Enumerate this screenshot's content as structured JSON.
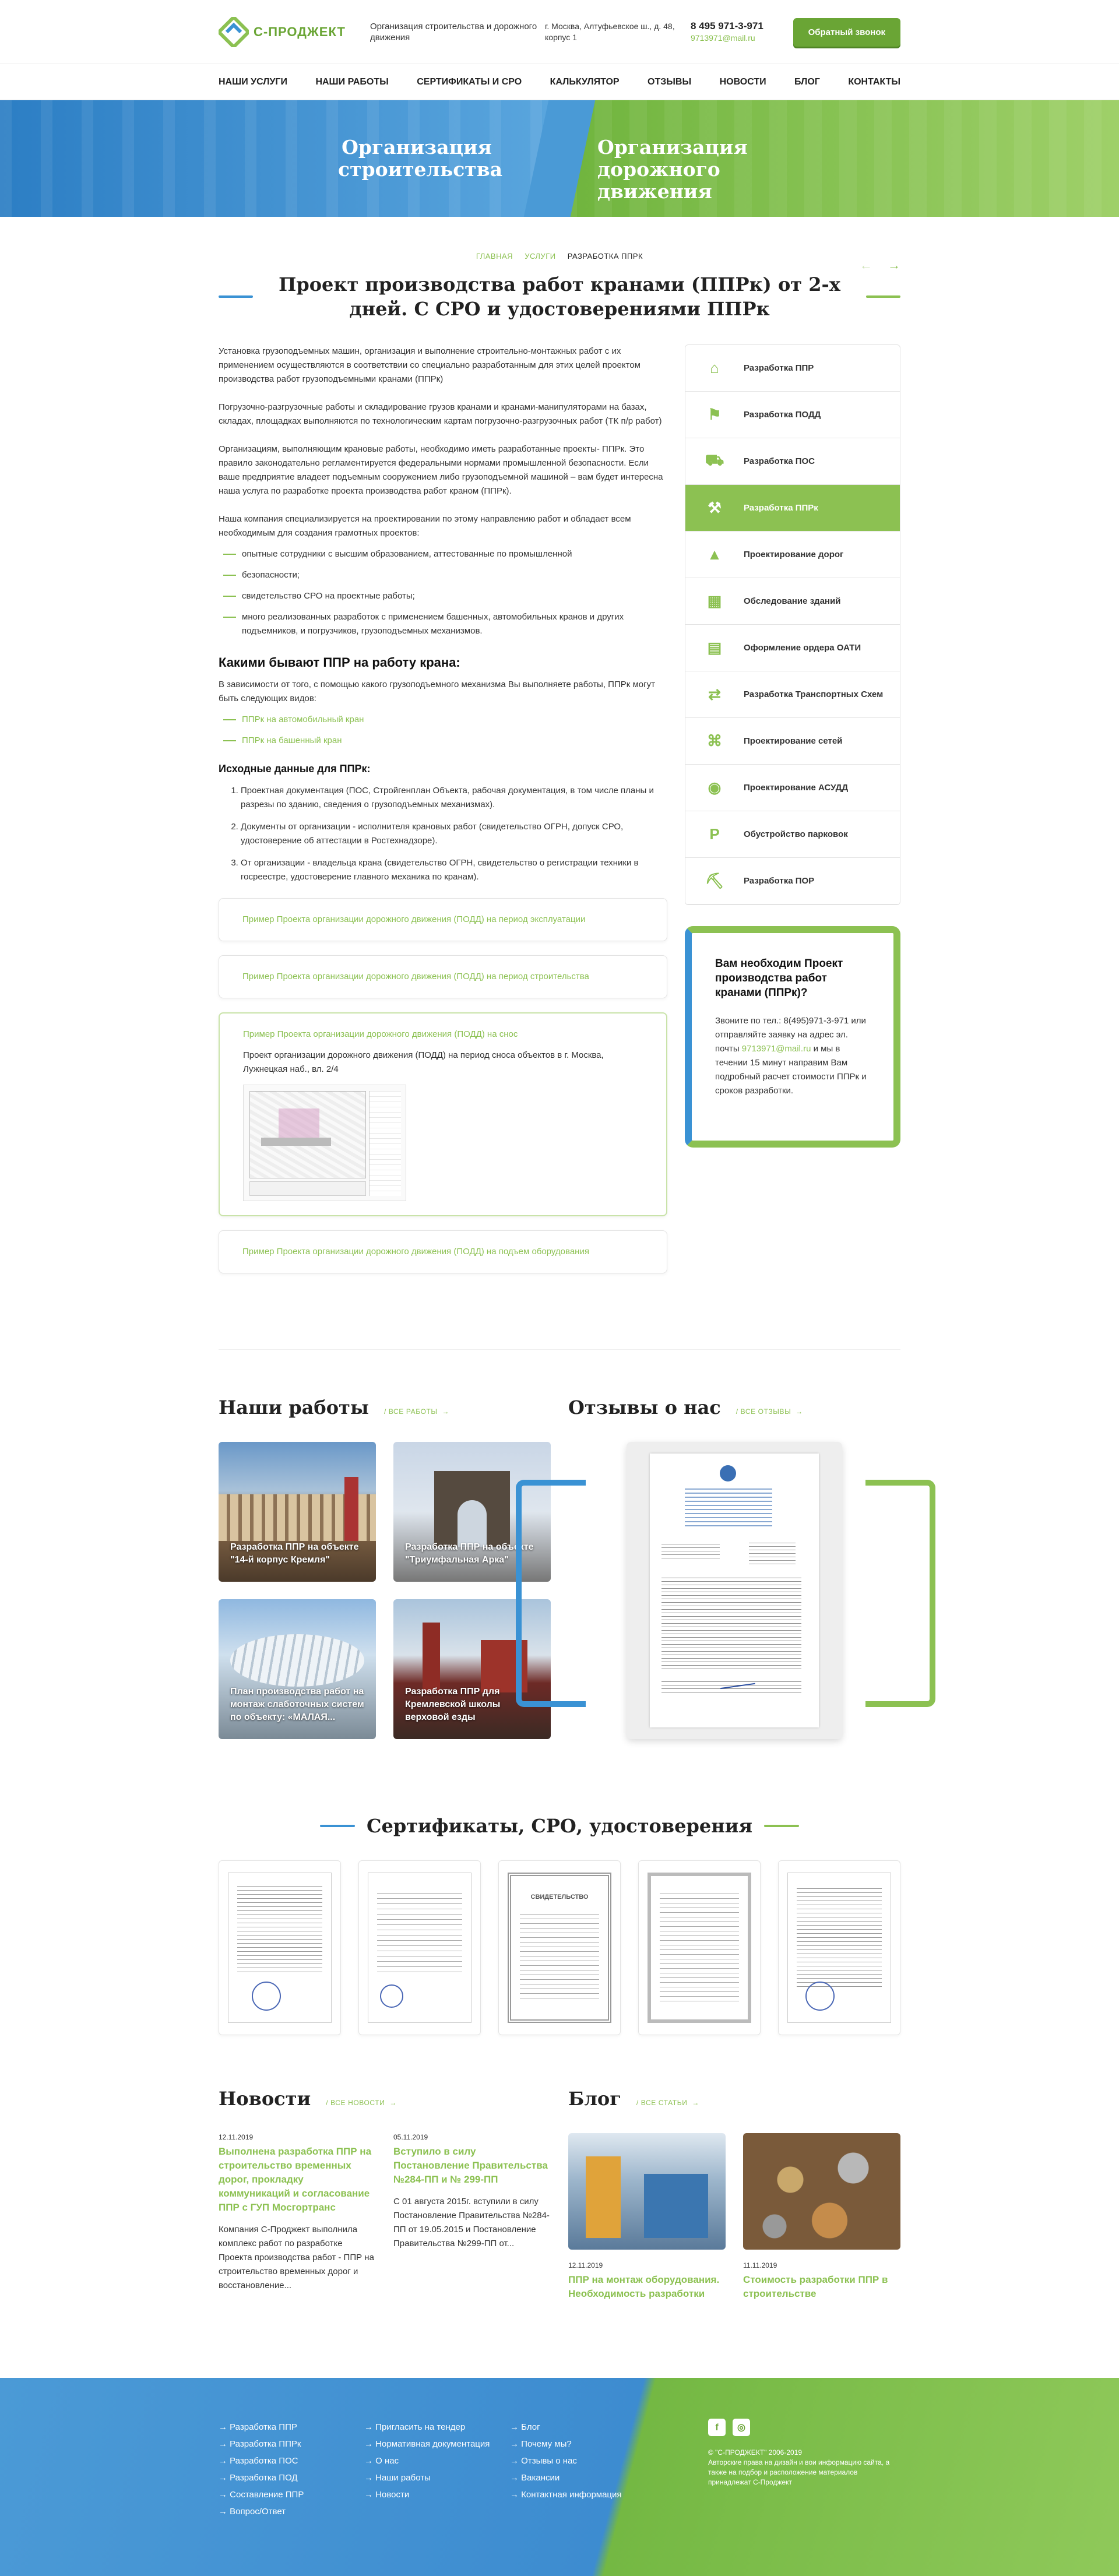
{
  "header": {
    "logo_text": "С-ПРОДЖЕКТ",
    "tagline": "Организация строительства и дорожного движения",
    "address": "г. Москва, Алтуфьевское ш., д. 48, корпус 1",
    "phone": "8 495 971-3-971",
    "email": "9713971@mail.ru",
    "callback_button": "Обратный звонок"
  },
  "nav": [
    "НАШИ УСЛУГИ",
    "НАШИ РАБОТЫ",
    "СЕРТИФИКАТЫ И СРО",
    "КАЛЬКУЛЯТОР",
    "ОТЗЫВЫ",
    "НОВОСТИ",
    "БЛОГ",
    "КОНТАКТЫ"
  ],
  "banner": {
    "left": "Организация строительства",
    "right": "Организация дорожного движения"
  },
  "breadcrumbs": [
    "ГЛАВНАЯ",
    "УСЛУГИ",
    "РАЗРАБОТКА ППРК"
  ],
  "page_title": "Проект производства работ кранами (ППРк) от 2-х дней. С СРО и удостоверениями ППРк",
  "content": {
    "p1": "Установка грузоподъемных машин, организация и выполнение строительно-монтажных работ с их применением осуществляются в соответствии со специально разработанным для этих целей проектом производства работ грузоподъемными кранами (ППРк)",
    "p2": "Погрузочно-разгрузочные работы и складирование грузов кранами и кранами-манипуляторами на базах, складах, площадках выполняются по технологическим картам погрузочно-разгрузочных работ (ТК п/р работ)",
    "p3": "Организациям, выполняющим крановые работы, необходимо иметь разработанные проекты- ППРк. Это правило законодательно регламентируется федеральными нормами промышленной безопасности. Если ваше предприятие владеет подъемным сооружением либо грузоподъемной машиной – вам будет интересна наша услуга по разработке проекта производства работ краном (ППРк).",
    "p4": "Наша компания специализируется на проектировании по этому направлению работ и обладает всем необходимым для создания грамотных проектов:",
    "list": [
      "опытные сотрудники с высшим образованием, аттестованные по промышленной",
      "безопасности;",
      "свидетельство СРО на проектные работы;",
      "много реализованных разработок с применением башенных, автомобильных кранов и других подъемников, и погрузчиков, грузоподъемных механизмов."
    ],
    "h_types": "Какими бывают ППР на работу крана:",
    "types_intro": "В зависимости от того, с помощью какого грузоподъемного механизма Вы выполняете работы, ППРк могут быть следующих видов:",
    "types": [
      "ППРк на автомобильный кран",
      "ППРк на башенный кран"
    ],
    "h_input": "Исходные данные для ППРк:",
    "input": [
      "Проектная документация (ПОС, Стройгенплан Объекта, рабочая документация, в том числе планы и разрезы по зданию, сведения о грузоподъемных механизмах).",
      "Документы от организации - исполнителя крановых работ (свидетельство ОГРН, допуск СРО, удостоверение об аттестации в Ростехнадзоре).",
      "От организации - владельца крана (свидетельство ОГРН, свидетельство о регистрации техники в госреестре, удостоверение главного механика по кранам)."
    ]
  },
  "examples": [
    "Пример Проекта организации дорожного движения (ПОДД) на период эксплуатации",
    "Пример Проекта организации дорожного движения (ПОДД) на период строительства",
    "Пример Проекта организации дорожного движения (ПОДД) на снос",
    "Пример Проекта организации дорожного движения (ПОДД) на подъем оборудования"
  ],
  "example_open_text": "Проект организации дорожного движения (ПОДД) на период сноса объектов в г. Москва, Лужнецкая наб., вл. 2/4",
  "sidebar": [
    {
      "label": "Разработка ППР",
      "icon": "house-crane-icon"
    },
    {
      "label": "Разработка ПОДД",
      "icon": "road-sign-icon"
    },
    {
      "label": "Разработка ПОС",
      "icon": "truck-icon"
    },
    {
      "label": "Разработка ППРк",
      "icon": "crane-icon"
    },
    {
      "label": "Проектирование дорог",
      "icon": "road-cone-icon"
    },
    {
      "label": "Обследование зданий",
      "icon": "building-icon"
    },
    {
      "label": "Оформление ордера ОАТИ",
      "icon": "document-icon"
    },
    {
      "label": "Разработка Транспортных Схем",
      "icon": "transport-scheme-icon"
    },
    {
      "label": "Проектирование сетей",
      "icon": "network-icon"
    },
    {
      "label": "Проектирование АСУДД",
      "icon": "traffic-light-icon"
    },
    {
      "label": "Обустройство парковок",
      "icon": "parking-icon"
    },
    {
      "label": "Разработка ПОР",
      "icon": "excavator-icon"
    }
  ],
  "callout": {
    "title": "Вам необходим Проект производства работ кранами (ППРк)?",
    "text_before": "Звоните по тел.: 8(495)971-3-971 или отправляйте заявку на адрес эл. почты",
    "email": "9713971@mail.ru",
    "text_after": "и мы в течении 15 минут направим Вам подробный расчет стоимости ППРк и сроков разработки."
  },
  "works": {
    "title": "Наши работы",
    "more": "ВСЕ РАБОТЫ",
    "items": [
      "Разработка ППР на объекте \"14-й корпус Кремля\"",
      "Разработка ППР на объекте \"Триумфальная Арка\"",
      "План производства работ на монтаж слаботочных систем по объекту: «МАЛАЯ...",
      "Разработка ППР для Кремлевской школы верховой езды"
    ]
  },
  "reviews": {
    "title": "Отзывы о нас",
    "more": "ВСЕ ОТЗЫВЫ"
  },
  "certs": {
    "title": "Сертификаты, СРО, удостоверения",
    "doc_title": "СВИДЕТЕЛЬСТВО"
  },
  "news": {
    "title": "Новости",
    "more": "ВСЕ НОВОСТИ",
    "items": [
      {
        "date": "12.11.2019",
        "title": "Выполнена разработка ППР на строительство временных дорог, прокладку коммуникаций и согласование ППР с ГУП Мосгортранс",
        "text": "Компания С-Проджект выполнила комплекс работ по разработке Проекта производства работ - ППР на строительство временных дорог и восстановление..."
      },
      {
        "date": "05.11.2019",
        "title": "Вступило в силу Постановление Правительства №284-ПП и № 299-ПП",
        "text": "С 01 августа 2015г. вступили в силу Постановление Правительства №284-ПП от 19.05.2015 и Постановление Правительства №299-ПП от..."
      }
    ]
  },
  "blog": {
    "title": "Блог",
    "more": "ВСЕ СТАТЬИ",
    "items": [
      {
        "date": "12.11.2019",
        "title": "ППР на монтаж оборудования. Необходимость разработки"
      },
      {
        "date": "11.11.2019",
        "title": "Стоимость разработки ППР в строительстве"
      }
    ]
  },
  "footer": {
    "col1": [
      "→ Разработка ППР",
      "→ Разработка ППРк",
      "→ Разработка ПОС",
      "→ Разработка ПОД",
      "→ Составление ППР",
      "→ Вопрос/Ответ"
    ],
    "col2": [
      "→ Пригласить на тендер",
      "→ Нормативная документация",
      "→ О нас",
      "→ Наши работы",
      "→ Новости"
    ],
    "col3": [
      "→ Блог",
      "→ Почему мы?",
      "→ Отзывы о нас",
      "→ Вакансии",
      "→ Контактная информация"
    ],
    "copyright": "© \"С-ПРОДЖЕКТ\" 2006-2019",
    "rights": "Авторские права на дизайн и вои информацию сайта, а также на подбор и расположение материалов принадлежат С-Проджект",
    "social": [
      "f",
      "◎"
    ]
  },
  "colors": {
    "green": "#8cc152",
    "blue": "#3a92d4"
  }
}
